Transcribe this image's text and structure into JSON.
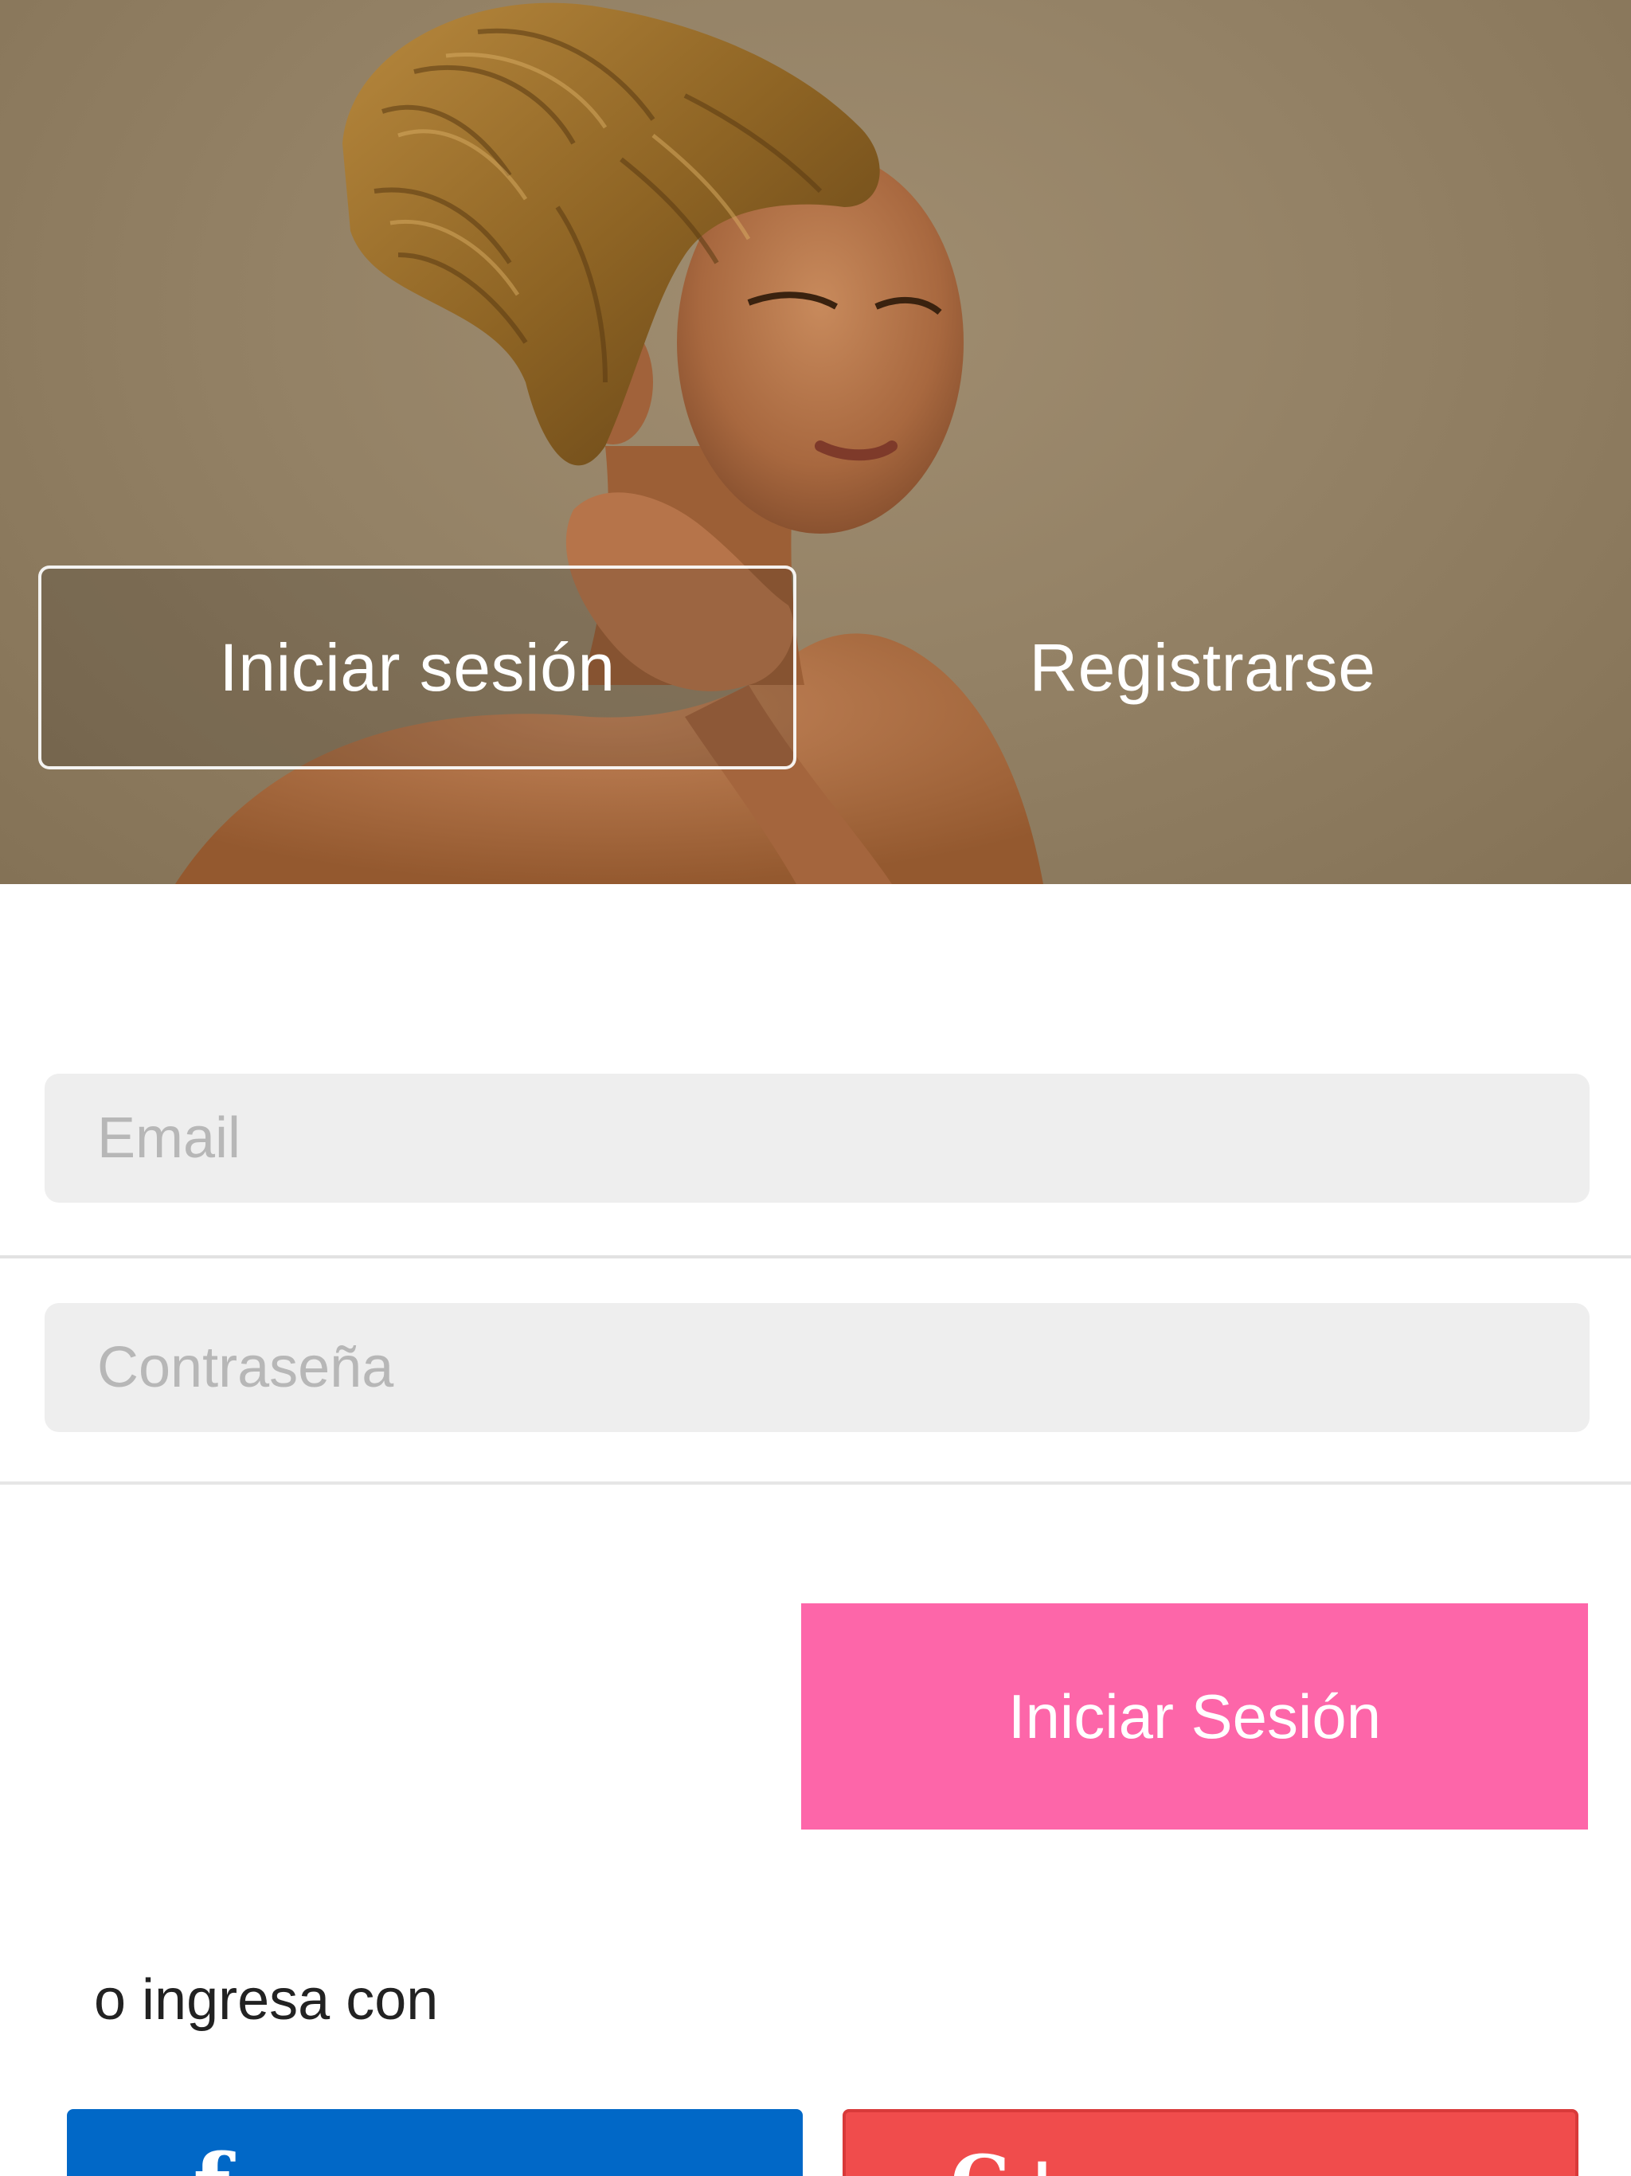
{
  "hero": {
    "tabs": {
      "login_label": "Iniciar sesión",
      "register_label": "Registrarse"
    }
  },
  "form": {
    "email": {
      "placeholder": "Email",
      "value": ""
    },
    "password": {
      "placeholder": "Contraseña",
      "value": ""
    },
    "submit_label": "Iniciar Sesión"
  },
  "social": {
    "or_text": "o ingresa con",
    "facebook": {
      "icon": "facebook-icon",
      "color": "#0168c7"
    },
    "google": {
      "icon": "google-plus-icon",
      "color": "#f04c4c"
    }
  },
  "colors": {
    "accent": "#fd66a9",
    "input_bg": "#eeeeee",
    "hero_bg": "#948266"
  }
}
